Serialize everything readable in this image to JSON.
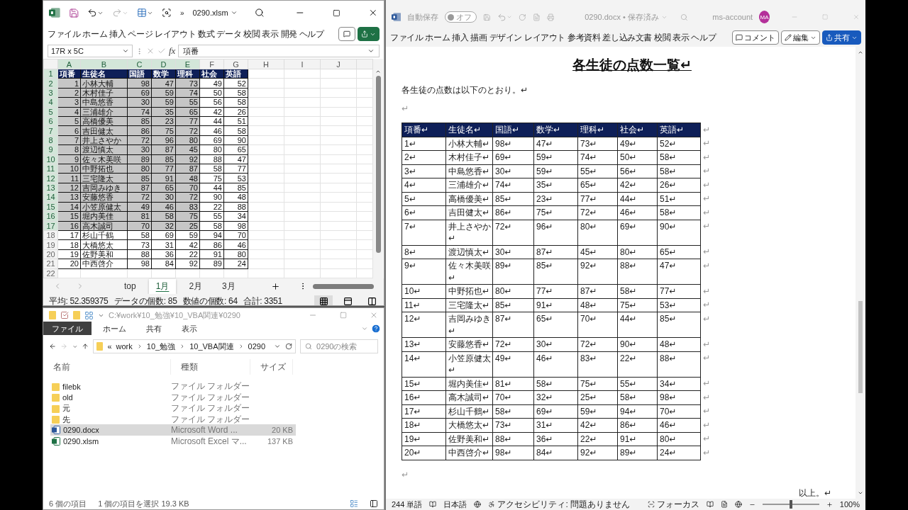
{
  "excel": {
    "title": "0290.xlsm",
    "more": "»",
    "menu": [
      "ファイル",
      "ホーム",
      "挿入",
      "ページ レイアウト",
      "数式",
      "データ",
      "校閲",
      "表示",
      "開発",
      "ヘルプ"
    ],
    "name_box": "17R x 5C",
    "fx": "fx",
    "formula": "項番",
    "column_letters": [
      "A",
      "B",
      "C",
      "D",
      "E",
      "F",
      "G",
      "H",
      "I",
      "J"
    ],
    "header_row": {
      "number": "1",
      "cells": [
        "項番",
        "生徒名",
        "国語",
        "数学",
        "理科",
        "社会",
        "英語"
      ]
    },
    "rows": [
      {
        "number": "2",
        "selected": true,
        "cells": [
          "1",
          "小林大輔",
          "98",
          "47",
          "73",
          "49",
          "52"
        ]
      },
      {
        "number": "3",
        "selected": true,
        "cells": [
          "2",
          "木村佳子",
          "69",
          "59",
          "74",
          "50",
          "58"
        ]
      },
      {
        "number": "4",
        "selected": true,
        "cells": [
          "3",
          "中島悠香",
          "30",
          "59",
          "55",
          "56",
          "58"
        ]
      },
      {
        "number": "5",
        "selected": true,
        "cells": [
          "4",
          "三浦雄介",
          "74",
          "35",
          "65",
          "42",
          "26"
        ]
      },
      {
        "number": "6",
        "selected": true,
        "cells": [
          "5",
          "高橋優美",
          "85",
          "23",
          "77",
          "44",
          "51"
        ]
      },
      {
        "number": "7",
        "selected": true,
        "cells": [
          "6",
          "吉田健太",
          "86",
          "75",
          "72",
          "46",
          "58"
        ]
      },
      {
        "number": "8",
        "selected": true,
        "cells": [
          "7",
          "井上さやか",
          "72",
          "96",
          "80",
          "69",
          "90"
        ]
      },
      {
        "number": "9",
        "selected": true,
        "cells": [
          "8",
          "渡辺慎太",
          "30",
          "87",
          "45",
          "80",
          "65"
        ]
      },
      {
        "number": "10",
        "selected": true,
        "cells": [
          "9",
          "佐々木美咲",
          "89",
          "85",
          "92",
          "88",
          "47"
        ]
      },
      {
        "number": "11",
        "selected": true,
        "cells": [
          "10",
          "中野拓也",
          "80",
          "77",
          "87",
          "58",
          "77"
        ]
      },
      {
        "number": "12",
        "selected": true,
        "cells": [
          "11",
          "三宅隆太",
          "85",
          "91",
          "48",
          "75",
          "53"
        ]
      },
      {
        "number": "13",
        "selected": true,
        "cells": [
          "12",
          "吉岡みゆき",
          "87",
          "65",
          "70",
          "44",
          "85"
        ]
      },
      {
        "number": "14",
        "selected": true,
        "cells": [
          "13",
          "安藤悠香",
          "72",
          "30",
          "72",
          "90",
          "48"
        ]
      },
      {
        "number": "15",
        "selected": true,
        "cells": [
          "14",
          "小笠原健太",
          "49",
          "46",
          "83",
          "22",
          "88"
        ]
      },
      {
        "number": "16",
        "selected": true,
        "cells": [
          "15",
          "堀内美佳",
          "81",
          "58",
          "75",
          "55",
          "34"
        ]
      },
      {
        "number": "17",
        "selected": true,
        "cells": [
          "16",
          "高木誠司",
          "70",
          "32",
          "25",
          "58",
          "98"
        ]
      },
      {
        "number": "18",
        "selected": false,
        "cells": [
          "17",
          "杉山千鶴",
          "58",
          "69",
          "59",
          "94",
          "70"
        ]
      },
      {
        "number": "19",
        "selected": false,
        "cells": [
          "18",
          "大橋悠太",
          "73",
          "31",
          "42",
          "86",
          "46"
        ]
      },
      {
        "number": "20",
        "selected": false,
        "cells": [
          "19",
          "佐野美和",
          "88",
          "36",
          "22",
          "91",
          "80"
        ]
      },
      {
        "number": "21",
        "selected": false,
        "cells": [
          "20",
          "中西啓介",
          "98",
          "84",
          "92",
          "89",
          "24"
        ]
      }
    ],
    "next_row": "22",
    "sheets": [
      {
        "label": "top",
        "selected": false
      },
      {
        "label": "1月",
        "selected": true
      },
      {
        "label": "2月",
        "selected": false
      },
      {
        "label": "3月",
        "selected": false
      }
    ],
    "status": [
      "平均: 52.359375",
      "データの個数: 85",
      "数値の個数: 64",
      "合計: 3351"
    ]
  },
  "explorer": {
    "path": "C:¥work¥10_勉強¥10_VBA関連¥0290",
    "tabs": [
      {
        "label": "ファイル",
        "selected": true
      },
      {
        "label": "ホーム",
        "selected": false
      },
      {
        "label": "共有",
        "selected": false
      },
      {
        "label": "表示",
        "selected": false
      }
    ],
    "breadcrumb_prefix": "«",
    "breadcrumb": [
      "work",
      "10_勉強",
      "10_VBA関連",
      "0290"
    ],
    "search_placeholder": "0290の検索",
    "columns": [
      "名前",
      "種類",
      "サイズ"
    ],
    "files": [
      {
        "name": "filebk",
        "kind": "folder",
        "type": "ファイル フォルダー",
        "selected": false
      },
      {
        "name": "old",
        "kind": "folder",
        "type": "ファイル フォルダー",
        "selected": false
      },
      {
        "name": "元",
        "kind": "folder",
        "type": "ファイル フォルダー",
        "selected": false
      },
      {
        "name": "先",
        "kind": "folder",
        "type": "ファイル フォルダー",
        "selected": false
      },
      {
        "name": "0290.docx",
        "kind": "word",
        "type": "Microsoft Word ...",
        "size": "20 KB",
        "selected": true
      },
      {
        "name": "0290.xlsm",
        "kind": "excel",
        "type": "Microsoft Excel マ...",
        "size": "137 KB",
        "selected": false
      }
    ],
    "status": [
      "6 個の項目",
      "1 個の項目を選択  19.3 KB"
    ]
  },
  "word": {
    "autosave_label": "自動保存",
    "autosave": {
      "on": false,
      "label": "オフ"
    },
    "title": "0290.docx • 保存済み",
    "account": "ms-account",
    "avatar": "MA",
    "menu": [
      "ファイル",
      "ホーム",
      "挿入",
      "描画",
      "デザイン",
      "レイアウト",
      "参考資料",
      "差し込み文書",
      "校閲",
      "表示",
      "ヘルプ"
    ],
    "comment_button": "コメント",
    "edit_button": "編集",
    "share_button": "共有",
    "heading": "各生徒の点数一覧↵",
    "intro": "各生徒の点数は以下のとおり。↵",
    "blank_before_table": "↵",
    "table": {
      "header": {
        "cells": [
          "項番↵",
          "生徒名↵",
          "国語↵",
          "数学↵",
          "理科↵",
          "社会↵",
          "英語↵"
        ],
        "end": "↵"
      },
      "rows": [
        {
          "cells": [
            "1↵",
            "小林大輔↵",
            "98↵",
            "47↵",
            "73↵",
            "49↵",
            "52↵"
          ],
          "end": "↵"
        },
        {
          "cells": [
            "2↵",
            "木村佳子↵",
            "69↵",
            "59↵",
            "74↵",
            "50↵",
            "58↵"
          ],
          "end": "↵"
        },
        {
          "cells": [
            "3↵",
            "中島悠香↵",
            "30↵",
            "59↵",
            "55↵",
            "56↵",
            "58↵"
          ],
          "end": "↵"
        },
        {
          "cells": [
            "4↵",
            "三浦雄介↵",
            "74↵",
            "35↵",
            "65↵",
            "42↵",
            "26↵"
          ],
          "end": "↵"
        },
        {
          "cells": [
            "5↵",
            "高橋優美↵",
            "85↵",
            "23↵",
            "77↵",
            "44↵",
            "51↵"
          ],
          "end": "↵"
        },
        {
          "cells": [
            "6↵",
            "吉田健太↵",
            "86↵",
            "75↵",
            "72↵",
            "46↵",
            "58↵"
          ],
          "end": "↵"
        },
        {
          "cells": [
            "7↵",
            "井上さやか↵",
            "72↵",
            "96↵",
            "80↵",
            "69↵",
            "90↵"
          ],
          "end": "↵"
        },
        {
          "cells": [
            "8↵",
            "渡辺慎太↵",
            "30↵",
            "87↵",
            "45↵",
            "80↵",
            "65↵"
          ],
          "end": "↵"
        },
        {
          "cells": [
            "9↵",
            "佐々木美咲↵",
            "89↵",
            "85↵",
            "92↵",
            "88↵",
            "47↵"
          ],
          "end": "↵"
        },
        {
          "cells": [
            "10↵",
            "中野拓也↵",
            "80↵",
            "77↵",
            "87↵",
            "58↵",
            "77↵"
          ],
          "end": "↵"
        },
        {
          "cells": [
            "11↵",
            "三宅隆太↵",
            "85↵",
            "91↵",
            "48↵",
            "75↵",
            "53↵"
          ],
          "end": "↵"
        },
        {
          "cells": [
            "12↵",
            "吉岡みゆき↵",
            "87↵",
            "65↵",
            "70↵",
            "44↵",
            "85↵"
          ],
          "end": "↵"
        },
        {
          "cells": [
            "13↵",
            "安藤悠香↵",
            "72↵",
            "30↵",
            "72↵",
            "90↵",
            "48↵"
          ],
          "end": "↵"
        },
        {
          "cells": [
            "14↵",
            "小笠原健太↵",
            "49↵",
            "46↵",
            "83↵",
            "22↵",
            "88↵"
          ],
          "end": "↵"
        },
        {
          "cells": [
            "15↵",
            "堀内美佳↵",
            "81↵",
            "58↵",
            "75↵",
            "55↵",
            "34↵"
          ],
          "end": "↵"
        },
        {
          "cells": [
            "16↵",
            "高木誠司↵",
            "70↵",
            "32↵",
            "25↵",
            "58↵",
            "98↵"
          ],
          "end": "↵"
        },
        {
          "cells": [
            "17↵",
            "杉山千鶴↵",
            "58↵",
            "69↵",
            "59↵",
            "94↵",
            "70↵"
          ],
          "end": "↵"
        },
        {
          "cells": [
            "18↵",
            "大橋悠太↵",
            "73↵",
            "31↵",
            "42↵",
            "86↵",
            "46↵"
          ],
          "end": "↵"
        },
        {
          "cells": [
            "19↵",
            "佐野美和↵",
            "88↵",
            "36↵",
            "22↵",
            "91↵",
            "80↵"
          ],
          "end": "↵"
        },
        {
          "cells": [
            "20↵",
            "中西啓介↵",
            "98↵",
            "84↵",
            "92↵",
            "89↵",
            "24↵"
          ],
          "end": "↵"
        }
      ]
    },
    "blank_after_table": "↵",
    "closing": "以上。↵",
    "status": {
      "words": "244 単語",
      "language": "日本語",
      "accessibility": "アクセシビリティ: 問題ありません",
      "focus": "フォーカス",
      "zoom": "100%",
      "zoom_slider": {
        "level": 0.5
      }
    }
  }
}
